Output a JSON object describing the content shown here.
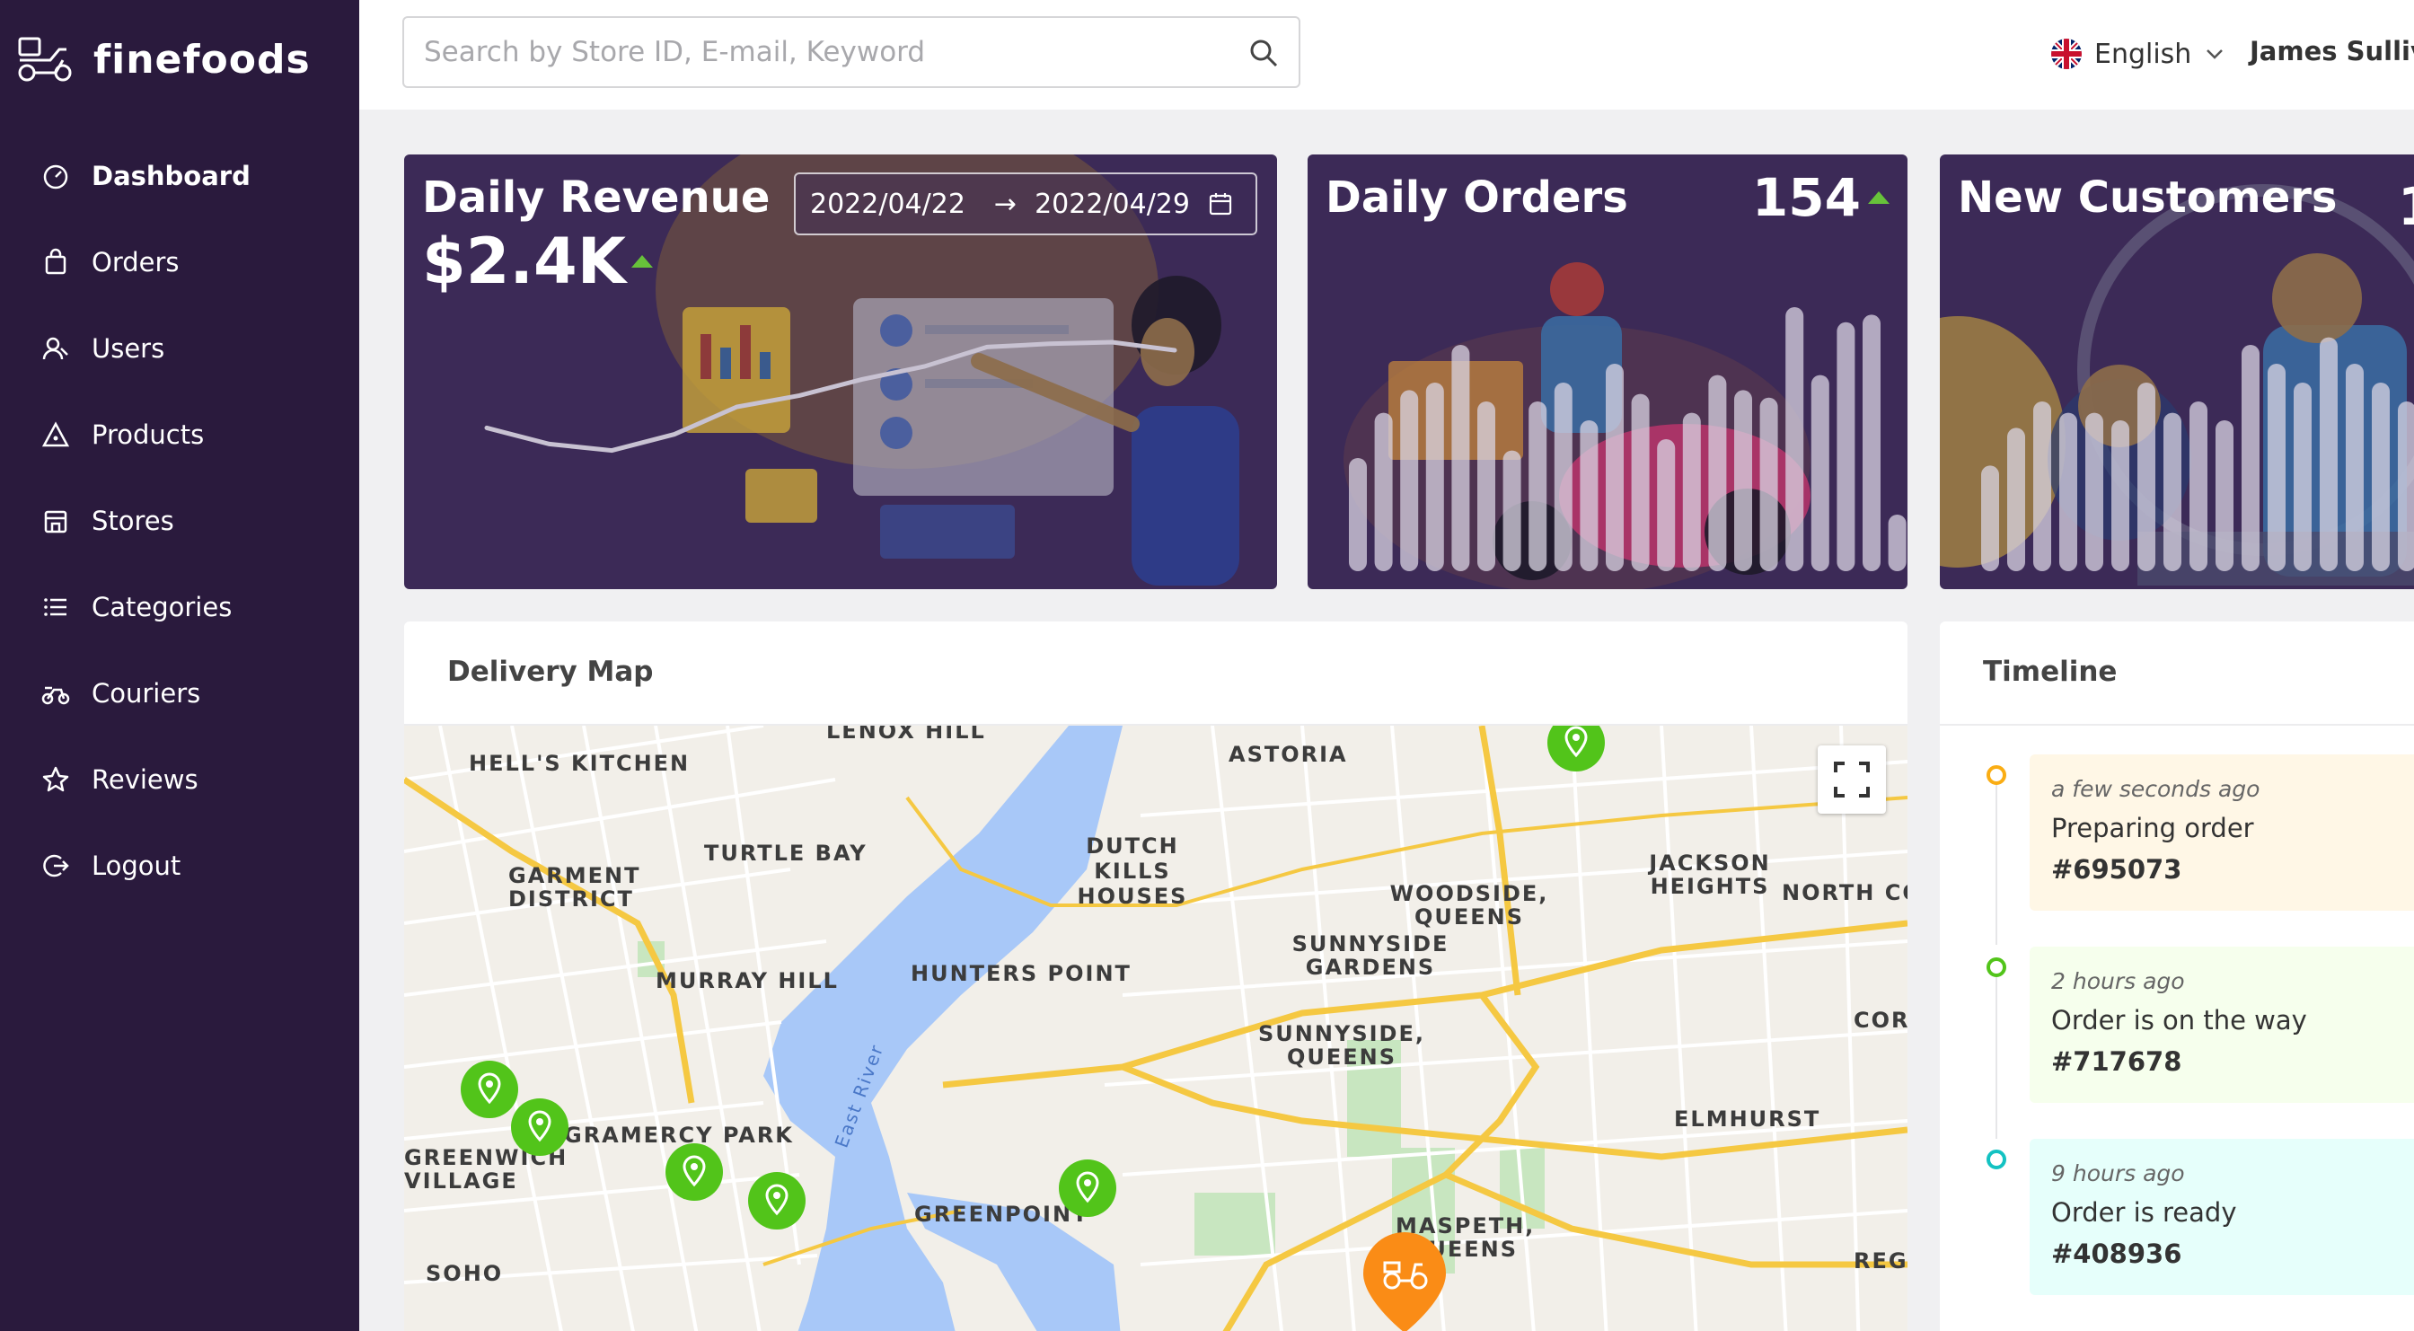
{
  "brand": {
    "name": "finefoods"
  },
  "sidebar": {
    "items": [
      {
        "label": "Dashboard",
        "icon": "dashboard-icon"
      },
      {
        "label": "Orders",
        "icon": "shopping-bag-icon"
      },
      {
        "label": "Users",
        "icon": "users-icon"
      },
      {
        "label": "Products",
        "icon": "pizza-icon"
      },
      {
        "label": "Stores",
        "icon": "store-icon"
      },
      {
        "label": "Categories",
        "icon": "list-icon"
      },
      {
        "label": "Couriers",
        "icon": "bike-icon"
      },
      {
        "label": "Reviews",
        "icon": "star-icon"
      },
      {
        "label": "Logout",
        "icon": "logout-icon"
      }
    ]
  },
  "header": {
    "search_placeholder": "Search by Store ID, E-mail, Keyword",
    "language": "English",
    "user_name": "James Sullivan"
  },
  "cards": {
    "revenue": {
      "title": "Daily Revenue",
      "value": "$2.4K",
      "date_start": "2022/04/22",
      "date_end": "2022/04/29",
      "arrow": "→"
    },
    "orders": {
      "title": "Daily Orders",
      "value": "154"
    },
    "customers": {
      "title": "New Customers",
      "value": "1"
    }
  },
  "chart_data": [
    {
      "type": "line",
      "title": "",
      "values": [
        0.58,
        0.68,
        0.72,
        0.62,
        0.45,
        0.38,
        0.28,
        0.2,
        0.08,
        0.06,
        0.05,
        0.1
      ]
    },
    {
      "type": "bar",
      "title": "",
      "values": [
        0.3,
        0.42,
        0.48,
        0.5,
        0.6,
        0.45,
        0.32,
        0.45,
        0.5,
        0.4,
        0.55,
        0.47,
        0.35,
        0.42,
        0.52,
        0.48,
        0.46,
        0.7,
        0.52,
        0.66,
        0.68,
        0.15
      ]
    },
    {
      "type": "bar",
      "title": "",
      "values": [
        0.28,
        0.38,
        0.45,
        0.42,
        0.42,
        0.4,
        0.5,
        0.42,
        0.45,
        0.4,
        0.6,
        0.55,
        0.5,
        0.62,
        0.55,
        0.5,
        0.45,
        0.58,
        0.42
      ]
    }
  ],
  "map": {
    "title": "Delivery Map",
    "labels": [
      "LENOX HILL",
      "HELL'S KITCHEN",
      "TURTLE BAY",
      "GARMENT DISTRICT",
      "MURRAY HILL",
      "ASTORIA",
      "DUTCH KILLS HOUSES",
      "HUNTERS POINT",
      "WOODSIDE, QUEENS",
      "SUNNYSIDE GARDENS",
      "SUNNYSIDE, QUEENS",
      "JACKSON HEIGHTS",
      "NORTH COR",
      "ELMHURST",
      "CORO",
      "GREENPOINT",
      "MASPETH, QUEENS",
      "GRAMERCY PARK",
      "GREENWICH VILLAGE",
      "SOHO",
      "East River",
      "REGO"
    ]
  },
  "timeline": {
    "title": "Timeline",
    "items": [
      {
        "time": "a few seconds ago",
        "status": "Preparing order",
        "order": "#695073",
        "color": "#faad14",
        "bg": "#fff7e6"
      },
      {
        "time": "2 hours ago",
        "status": "Order is on the way",
        "order": "#717678",
        "color": "#52c41a",
        "bg": "#f6ffed"
      },
      {
        "time": "9 hours ago",
        "status": "Order is ready",
        "order": "#408936",
        "color": "#13c2c2",
        "bg": "#e6fffb"
      }
    ]
  }
}
